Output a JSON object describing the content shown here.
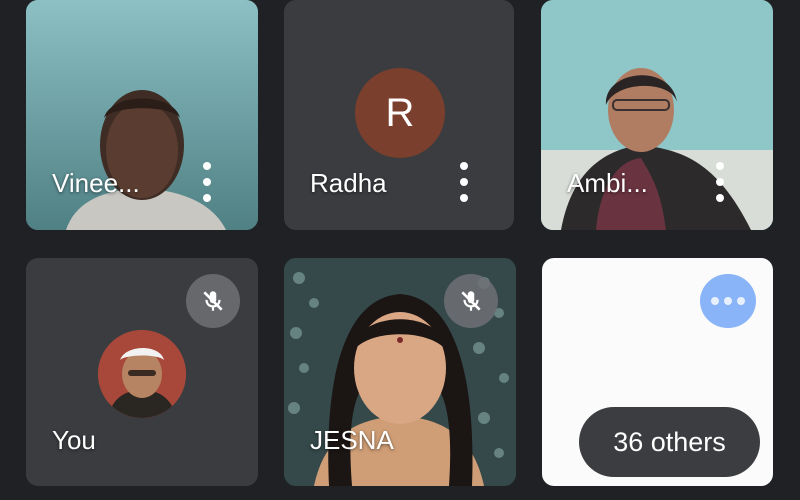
{
  "participants": [
    {
      "name": "Vinee...",
      "camera": "on"
    },
    {
      "name": "Radha",
      "camera": "off",
      "avatar_letter": "R",
      "avatar_color": "#7b3f2e"
    },
    {
      "name": "Ambi...",
      "camera": "on"
    },
    {
      "name": "You",
      "camera": "off",
      "muted": true
    },
    {
      "name": "JESNA",
      "camera": "on",
      "muted": true
    },
    {
      "name": "",
      "camera": "on"
    }
  ],
  "others": {
    "label": "36 others"
  },
  "icons": {
    "more": "more-vertical-icon",
    "mute": "mic-off-icon",
    "overflow": "more-horizontal-icon"
  },
  "colors": {
    "background": "#1f2124",
    "tile": "#3a3c40",
    "overflow_button": "#8ab4f8"
  }
}
